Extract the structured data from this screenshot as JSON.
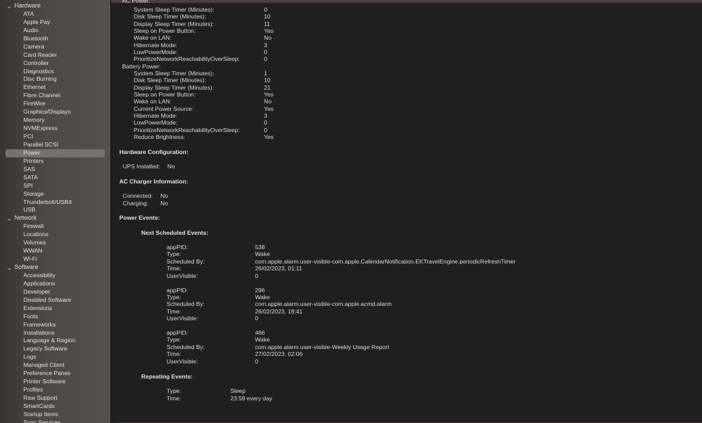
{
  "sidebar": {
    "groups": [
      {
        "label": "Hardware",
        "items": [
          "ATA",
          "Apple Pay",
          "Audio",
          "Bluetooth",
          "Camera",
          "Card Reader",
          "Controller",
          "Diagnostics",
          "Disc Burning",
          "Ethernet",
          "Fibre Channel",
          "FireWire",
          "Graphics/Displays",
          "Memory",
          "NVMExpress",
          "PCI",
          "Parallel SCSI",
          "Power",
          "Printers",
          "SAS",
          "SATA",
          "SPI",
          "Storage",
          "Thunderbolt/USB4",
          "USB"
        ]
      },
      {
        "label": "Network",
        "items": [
          "Firewall",
          "Locations",
          "Volumes",
          "WWAN",
          "Wi-Fi"
        ]
      },
      {
        "label": "Software",
        "items": [
          "Accessibility",
          "Applications",
          "Developer",
          "Disabled Software",
          "Extensions",
          "Fonts",
          "Frameworks",
          "Installations",
          "Language & Region",
          "Legacy Software",
          "Logs",
          "Managed Client",
          "Preference Panes",
          "Printer Software",
          "Profiles",
          "Raw Support",
          "SmartCards",
          "Startup Items",
          "Sync Services"
        ]
      }
    ],
    "selected": "Power",
    "chevron_icon": "chevron-down-icon"
  },
  "content": {
    "ac_power": {
      "title": "AC Power:",
      "rows": [
        {
          "label": "System Sleep Timer (Minutes):",
          "value": "0"
        },
        {
          "label": "Disk Sleep Timer (Minutes):",
          "value": "10"
        },
        {
          "label": "Display Sleep Timer (Minutes):",
          "value": "11"
        },
        {
          "label": "Sleep on Power Button:",
          "value": "Yes"
        },
        {
          "label": "Wake on LAN:",
          "value": "No"
        },
        {
          "label": "Hibernate Mode:",
          "value": "3"
        },
        {
          "label": "LowPowerMode:",
          "value": "0"
        },
        {
          "label": "PrioritizeNetworkReachabilityOverSleep:",
          "value": "0"
        }
      ]
    },
    "battery_power": {
      "title": "Battery Power:",
      "rows": [
        {
          "label": "System Sleep Timer (Minutes):",
          "value": "1"
        },
        {
          "label": "Disk Sleep Timer (Minutes):",
          "value": "10"
        },
        {
          "label": "Display Sleep Timer (Minutes):",
          "value": "21"
        },
        {
          "label": "Sleep on Power Button:",
          "value": "Yes"
        },
        {
          "label": "Wake on LAN:",
          "value": "No"
        },
        {
          "label": "Current Power Source:",
          "value": "Yes"
        },
        {
          "label": "Hibernate Mode:",
          "value": "3"
        },
        {
          "label": "LowPowerMode:",
          "value": "0"
        },
        {
          "label": "PrioritizeNetworkReachabilityOverSleep:",
          "value": "0"
        },
        {
          "label": "Reduce Brightness:",
          "value": "Yes"
        }
      ]
    },
    "hardware_configuration": {
      "title": "Hardware Configuration:",
      "rows": [
        {
          "label": "UPS Installed:",
          "value": "No"
        }
      ]
    },
    "ac_charger": {
      "title": "AC Charger Information:",
      "rows": [
        {
          "label": "Connected:",
          "value": "No"
        },
        {
          "label": "Charging:",
          "value": "No"
        }
      ]
    },
    "power_events": {
      "title": "Power Events:",
      "next_scheduled": {
        "title": "Next Scheduled Events:",
        "events": [
          [
            {
              "label": "appPID:",
              "value": "538"
            },
            {
              "label": "Type:",
              "value": "Wake"
            },
            {
              "label": "Scheduled By:",
              "value": "com.apple.alarm.user-visible-com.apple.CalendarNotification.EKTravelEngine.periodicRefreshTimer"
            },
            {
              "label": "Time:",
              "value": "26/02/2023, 01:11"
            },
            {
              "label": "UserVisible:",
              "value": "0"
            }
          ],
          [
            {
              "label": "appPID:",
              "value": "296"
            },
            {
              "label": "Type:",
              "value": "Wake"
            },
            {
              "label": "Scheduled By:",
              "value": "com.apple.alarm.user-visible-com.apple.acmd.alarm"
            },
            {
              "label": "Time:",
              "value": "26/02/2023, 18:41"
            },
            {
              "label": "UserVisible:",
              "value": "0"
            }
          ],
          [
            {
              "label": "appPID:",
              "value": "466"
            },
            {
              "label": "Type:",
              "value": "Wake"
            },
            {
              "label": "Scheduled By:",
              "value": "com.apple.alarm.user-visible-Weekly Usage Report"
            },
            {
              "label": "Time:",
              "value": "27/02/2023, 02:06"
            },
            {
              "label": "UserVisible:",
              "value": "0"
            }
          ]
        ]
      },
      "repeating": {
        "title": "Repeating Events:",
        "rows": [
          {
            "label": "Type:",
            "value": "Sleep"
          },
          {
            "label": "Time:",
            "value": "23:59 every day"
          }
        ]
      }
    }
  }
}
